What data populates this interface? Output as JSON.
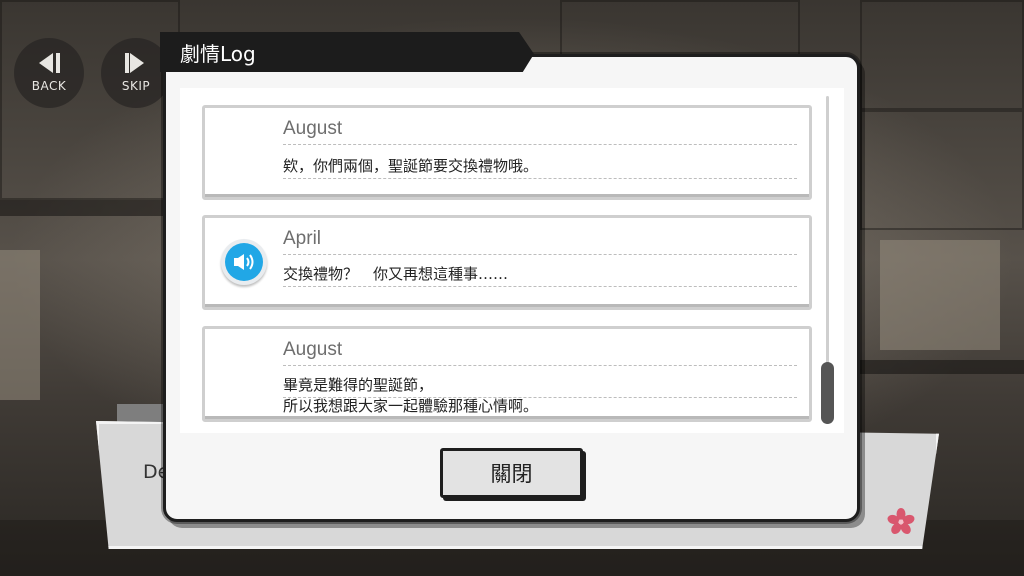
{
  "controls": {
    "back_label": "BACK",
    "skip_label": "SKIP"
  },
  "modal": {
    "title": "劇情Log",
    "close_label": "關閉"
  },
  "log": [
    {
      "speaker": "August",
      "has_voice": false,
      "lines": [
        "欸，你們兩個，聖誕節要交換禮物哦。"
      ]
    },
    {
      "speaker": "April",
      "has_voice": true,
      "lines": [
        "交換禮物？　你又再想這種事……"
      ]
    },
    {
      "speaker": "August",
      "has_voice": false,
      "lines": [
        "畢竟是難得的聖誕節，",
        "所以我想跟大家一起體驗那種心情啊。"
      ]
    }
  ],
  "dialogue": {
    "speaker_partial": "De"
  },
  "colors": {
    "voice_accent": "#21a7e6",
    "sakura": "#d9576e",
    "title_bar": "#1c1c1c"
  },
  "icons": {
    "back": "skip-back-icon",
    "skip": "skip-forward-icon",
    "voice": "speaker-icon",
    "flower": "sakura-icon"
  }
}
